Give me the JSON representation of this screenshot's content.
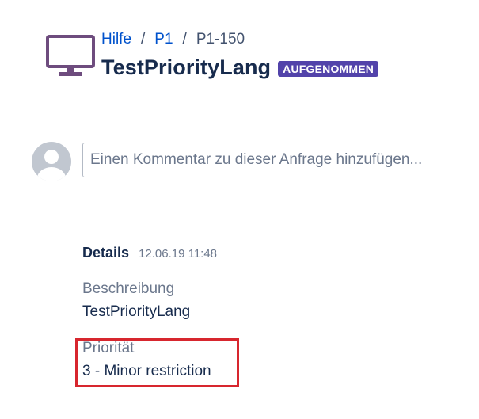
{
  "header": {
    "project_icon": "monitor-icon",
    "breadcrumb": {
      "items": [
        "Hilfe",
        "P1"
      ],
      "separator": "/",
      "current": "P1-150"
    },
    "title": "TestPriorityLang",
    "status": "AUFGENOMMEN",
    "status_color": "#5243aa"
  },
  "comment": {
    "avatar_icon": "user-avatar-icon",
    "placeholder": "Einen Kommentar zu dieser Anfrage hinzufügen..."
  },
  "details": {
    "heading": "Details",
    "timestamp": "12.06.19 11:48",
    "fields": [
      {
        "label": "Beschreibung",
        "value": "TestPriorityLang"
      },
      {
        "label": "Priorität",
        "value": "3 - Minor restriction"
      }
    ]
  },
  "colors": {
    "link": "#0052cc",
    "highlight": "#d7262e",
    "icon": "#6e4c7e"
  }
}
